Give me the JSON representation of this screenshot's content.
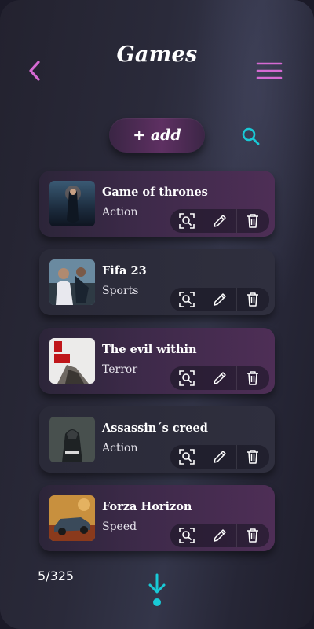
{
  "header": {
    "title": "Games",
    "back_icon": "chevron-left-icon",
    "menu_icon": "hamburger-menu-icon"
  },
  "toolbar": {
    "add_label": "+ add",
    "search_icon": "search-icon"
  },
  "games": [
    {
      "name": "Game of thrones",
      "genre": "Action",
      "thumb": "game-of-thrones-cover"
    },
    {
      "name": "Fifa 23",
      "genre": "Sports",
      "thumb": "fifa-23-cover"
    },
    {
      "name": "The evil within",
      "genre": "Terror",
      "thumb": "the-evil-within-cover"
    },
    {
      "name": "Assassin´s creed",
      "genre": "Action",
      "thumb": "assassins-creed-cover"
    },
    {
      "name": "Forza Horizon",
      "genre": "Speed",
      "thumb": "forza-horizon-cover"
    }
  ],
  "card_actions": [
    "view-icon",
    "edit-pencil-icon",
    "delete-trash-icon"
  ],
  "footer": {
    "pagination": "5/325",
    "load_more_icon": "arrow-down-icon"
  },
  "colors": {
    "accent_pink": "#d66ad3",
    "accent_cyan": "#19c9d6",
    "card_purple": "#4e2e56",
    "background": "#2a2a3a"
  }
}
